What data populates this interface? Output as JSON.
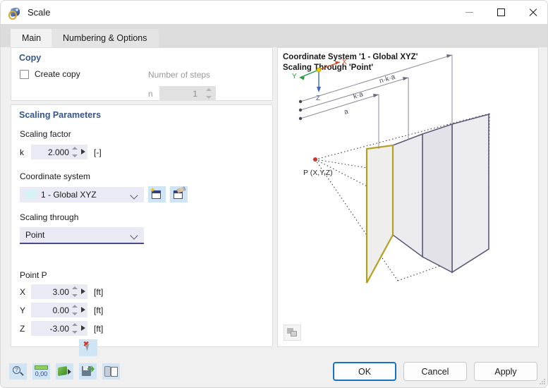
{
  "window": {
    "title": "Scale",
    "app_icon": "scale-tool-icon",
    "minimize_label": "Minimize",
    "maximize_label": "Maximize",
    "close_label": "Close"
  },
  "tabs": [
    {
      "label": "Main",
      "active": true
    },
    {
      "label": "Numbering & Options",
      "active": false
    }
  ],
  "copy": {
    "group_title": "Copy",
    "create_copy_label": "Create copy",
    "create_copy_checked": false,
    "number_of_steps_label": "Number of steps",
    "n_label": "n",
    "n_value": "1",
    "n_enabled": false
  },
  "scaling": {
    "group_title": "Scaling Parameters",
    "scaling_factor_label": "Scaling factor",
    "k_label": "k",
    "k_value": "2.000",
    "k_unit": "[-]",
    "coordinate_system_label": "Coordinate system",
    "coordinate_system_value": "1 - Global XYZ",
    "coordinate_system_color": "#d6f2f4",
    "new_cs_button": "new-coordinate-system",
    "edit_cs_button": "edit-coordinate-system",
    "scaling_through_label": "Scaling through",
    "scaling_through_value": "Point",
    "point_group_label": "Point P",
    "x_label": "X",
    "x_value": "3.00",
    "x_unit": "[ft]",
    "y_label": "Y",
    "y_value": "0.00",
    "y_unit": "[ft]",
    "z_label": "Z",
    "z_value": "-3.00",
    "z_unit": "[ft]",
    "pick_button": "pick-point-in-model"
  },
  "preview": {
    "caption": "Coordinate System '1 - Global XYZ'\nScaling Through 'Point'",
    "axis_x": "X",
    "axis_y": "Y",
    "axis_z": "Z",
    "point_label": "P (X,Y,Z)",
    "dim_a": "a",
    "dim_ka": "k·a",
    "dim_nka": "n·k·a",
    "highlight_color": "#b3a01e",
    "plane_stroke": "#5a5a77",
    "plane_fill": "#eeeef2",
    "thumbnail_icon": "render-preview-icon"
  },
  "toolbar": [
    {
      "name": "help-info-icon"
    },
    {
      "name": "units-decimals-icon",
      "text": "0,00"
    },
    {
      "name": "render-settings-icon"
    },
    {
      "name": "save-configuration-icon"
    },
    {
      "name": "import-export-icon"
    }
  ],
  "buttons": {
    "ok": "OK",
    "cancel": "Cancel",
    "apply": "Apply"
  }
}
